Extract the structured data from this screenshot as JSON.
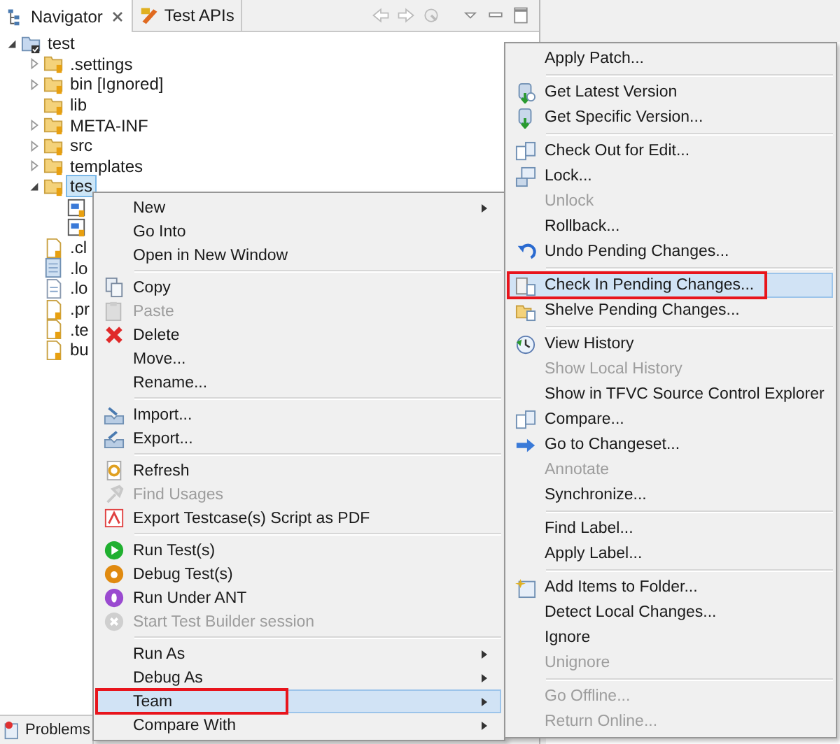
{
  "navigator": {
    "tabs": [
      {
        "label": "Navigator",
        "selected": true
      },
      {
        "label": "Test APIs",
        "selected": false
      }
    ],
    "tree": [
      {
        "label": "test",
        "kind": "project",
        "expanded": true,
        "selected": false,
        "children": [
          {
            "label": ".settings",
            "kind": "folder",
            "expanded": false,
            "selected": false
          },
          {
            "label": "bin [Ignored]",
            "kind": "folder",
            "expanded": false,
            "selected": false
          },
          {
            "label": "lib",
            "kind": "folder",
            "selected": false
          },
          {
            "label": "META-INF",
            "kind": "folder",
            "expanded": false,
            "selected": false
          },
          {
            "label": "src",
            "kind": "folder",
            "expanded": false,
            "selected": false
          },
          {
            "label": "templates",
            "kind": "folder",
            "expanded": false,
            "selected": false
          },
          {
            "label": "tes",
            "kind": "folder",
            "expanded": true,
            "selected": true,
            "children": [
              {
                "kind": "testfile",
                "selected": false
              },
              {
                "kind": "testfile",
                "selected": false
              }
            ]
          },
          {
            "label": ".cl",
            "kind": "file",
            "selected": false
          },
          {
            "label": ".lo",
            "kind": "log",
            "selected": false
          },
          {
            "label": ".lo",
            "kind": "text",
            "selected": false
          },
          {
            "label": ".pr",
            "kind": "file",
            "selected": false
          },
          {
            "label": ".te",
            "kind": "file",
            "selected": false
          },
          {
            "label": "bu",
            "kind": "file",
            "selected": false
          }
        ]
      }
    ]
  },
  "bottom_tabs": [
    {
      "label": "Problems",
      "selected": false
    }
  ],
  "context_menu": {
    "groups": [
      [
        {
          "label": "New",
          "submenu": true,
          "disabled": false,
          "selected": false,
          "outlined": false
        },
        {
          "label": "Go Into",
          "submenu": false,
          "disabled": false,
          "selected": false,
          "outlined": false
        },
        {
          "label": "Open in New Window",
          "submenu": false,
          "disabled": false,
          "selected": false,
          "outlined": false
        }
      ],
      [
        {
          "label": "Copy",
          "submenu": false,
          "disabled": false,
          "selected": false,
          "outlined": false
        },
        {
          "label": "Paste",
          "submenu": false,
          "disabled": true,
          "selected": false,
          "outlined": false
        },
        {
          "label": "Delete",
          "submenu": false,
          "disabled": false,
          "selected": false,
          "outlined": false
        },
        {
          "label": "Move...",
          "submenu": false,
          "disabled": false,
          "selected": false,
          "outlined": false
        },
        {
          "label": "Rename...",
          "submenu": false,
          "disabled": false,
          "selected": false,
          "outlined": false
        }
      ],
      [
        {
          "label": "Import...",
          "submenu": false,
          "disabled": false,
          "selected": false,
          "outlined": false
        },
        {
          "label": "Export...",
          "submenu": false,
          "disabled": false,
          "selected": false,
          "outlined": false
        }
      ],
      [
        {
          "label": "Refresh",
          "submenu": false,
          "disabled": false,
          "selected": false,
          "outlined": false
        },
        {
          "label": "Find Usages",
          "submenu": false,
          "disabled": true,
          "selected": false,
          "outlined": false
        },
        {
          "label": "Export Testcase(s) Script as PDF",
          "submenu": false,
          "disabled": false,
          "selected": false,
          "outlined": false
        }
      ],
      [
        {
          "label": "Run Test(s)",
          "submenu": false,
          "disabled": false,
          "selected": false,
          "outlined": false
        },
        {
          "label": "Debug Test(s)",
          "submenu": false,
          "disabled": false,
          "selected": false,
          "outlined": false
        },
        {
          "label": "Run Under ANT",
          "submenu": false,
          "disabled": false,
          "selected": false,
          "outlined": false
        },
        {
          "label": "Start Test Builder session",
          "submenu": false,
          "disabled": true,
          "selected": false,
          "outlined": false
        }
      ],
      [
        {
          "label": "Run As",
          "submenu": true,
          "disabled": false,
          "selected": false,
          "outlined": false
        },
        {
          "label": "Debug As",
          "submenu": true,
          "disabled": false,
          "selected": false,
          "outlined": false
        },
        {
          "label": "Team",
          "submenu": true,
          "disabled": false,
          "selected": true,
          "outlined": true
        },
        {
          "label": "Compare With",
          "submenu": true,
          "disabled": false,
          "selected": false,
          "outlined": false
        }
      ]
    ]
  },
  "team_submenu": {
    "groups": [
      [
        {
          "label": "Apply Patch...",
          "disabled": false,
          "selected": false,
          "outlined": false
        }
      ],
      [
        {
          "label": "Get Latest Version",
          "disabled": false,
          "selected": false,
          "outlined": false
        },
        {
          "label": "Get Specific Version...",
          "disabled": false,
          "selected": false,
          "outlined": false
        }
      ],
      [
        {
          "label": "Check Out for Edit...",
          "disabled": false,
          "selected": false,
          "outlined": false
        },
        {
          "label": "Lock...",
          "disabled": false,
          "selected": false,
          "outlined": false
        },
        {
          "label": "Unlock",
          "disabled": true,
          "selected": false,
          "outlined": false
        },
        {
          "label": "Rollback...",
          "disabled": false,
          "selected": false,
          "outlined": false
        },
        {
          "label": "Undo Pending Changes...",
          "disabled": false,
          "selected": false,
          "outlined": false
        }
      ],
      [
        {
          "label": "Check In Pending Changes...",
          "disabled": false,
          "selected": true,
          "outlined": true
        },
        {
          "label": "Shelve Pending Changes...",
          "disabled": false,
          "selected": false,
          "outlined": false
        }
      ],
      [
        {
          "label": "View History",
          "disabled": false,
          "selected": false,
          "outlined": false
        },
        {
          "label": "Show Local History",
          "disabled": true,
          "selected": false,
          "outlined": false
        },
        {
          "label": "Show in TFVC Source Control Explorer",
          "disabled": false,
          "selected": false,
          "outlined": false
        },
        {
          "label": "Compare...",
          "disabled": false,
          "selected": false,
          "outlined": false
        },
        {
          "label": "Go to Changeset...",
          "disabled": false,
          "selected": false,
          "outlined": false
        },
        {
          "label": "Annotate",
          "disabled": true,
          "selected": false,
          "outlined": false
        },
        {
          "label": "Synchronize...",
          "disabled": false,
          "selected": false,
          "outlined": false
        }
      ],
      [
        {
          "label": "Find Label...",
          "disabled": false,
          "selected": false,
          "outlined": false
        },
        {
          "label": "Apply Label...",
          "disabled": false,
          "selected": false,
          "outlined": false
        }
      ],
      [
        {
          "label": "Add Items to Folder...",
          "disabled": false,
          "selected": false,
          "outlined": false
        },
        {
          "label": "Detect Local Changes...",
          "disabled": false,
          "selected": false,
          "outlined": false
        },
        {
          "label": "Ignore",
          "disabled": false,
          "selected": false,
          "outlined": false
        },
        {
          "label": "Unignore",
          "disabled": true,
          "selected": false,
          "outlined": false
        }
      ],
      [
        {
          "label": "Go Offline...",
          "disabled": true,
          "selected": false,
          "outlined": false
        },
        {
          "label": "Return Online...",
          "disabled": true,
          "selected": false,
          "outlined": false
        }
      ]
    ]
  }
}
